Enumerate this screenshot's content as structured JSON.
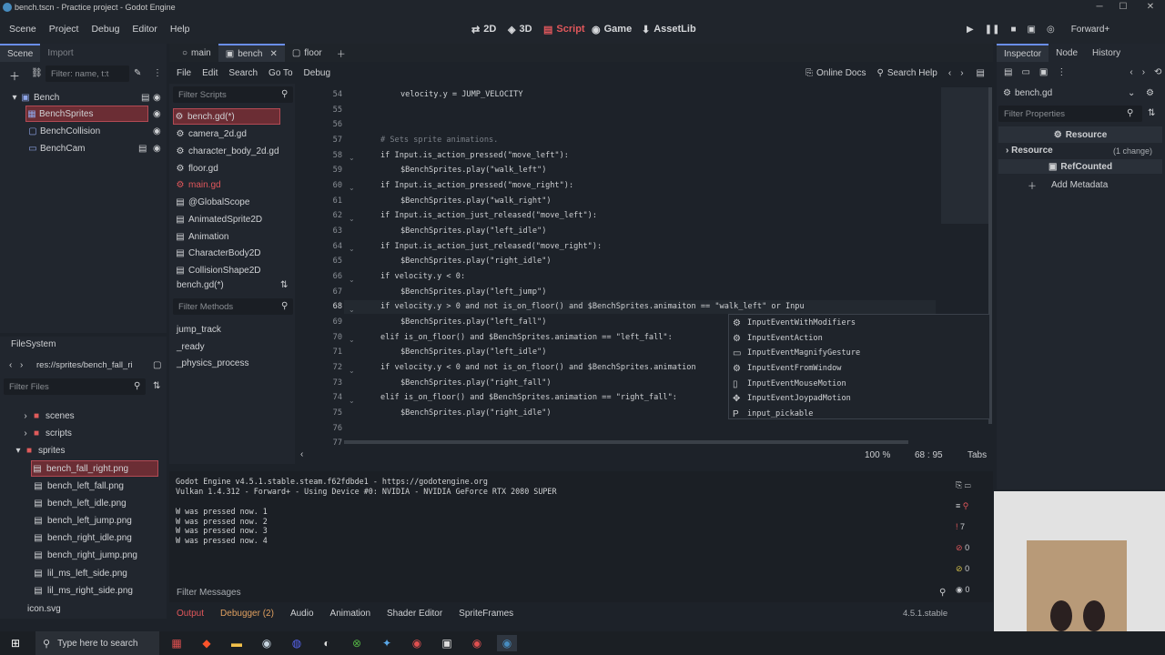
{
  "window": {
    "title": "bench.tscn - Practice project - Godot Engine"
  },
  "menu": [
    "Scene",
    "Project",
    "Debug",
    "Editor",
    "Help"
  ],
  "modes": [
    {
      "label": "2D"
    },
    {
      "label": "3D"
    },
    {
      "label": "Script"
    },
    {
      "label": "Game"
    },
    {
      "label": "AssetLib"
    }
  ],
  "renderer": "Forward+",
  "scene_panel": {
    "tabs": [
      "Scene",
      "Import"
    ],
    "filter_placeholder": "Filter: name, t:t",
    "nodes": [
      "Bench",
      "BenchSprites",
      "BenchCollision",
      "BenchCam"
    ]
  },
  "filesystem": {
    "title": "FileSystem",
    "path": "res://sprites/bench_fall_ri",
    "filter_placeholder": "Filter Files",
    "folders": [
      "scenes",
      "scripts",
      "sprites"
    ],
    "files": [
      "bench_fall_right.png",
      "bench_left_fall.png",
      "bench_left_idle.png",
      "bench_left_jump.png",
      "bench_right_idle.png",
      "bench_right_jump.png",
      "lil_ms_left_side.png",
      "lil_ms_right_side.png"
    ],
    "bottom_file": "icon.svg"
  },
  "editor_tabs": [
    "main",
    "bench",
    "floor"
  ],
  "script_menu": [
    "File",
    "Edit",
    "Search",
    "Go To",
    "Debug"
  ],
  "script_toolbar": {
    "online_docs": "Online Docs",
    "search_help": "Search Help"
  },
  "scripts_panel": {
    "filter_placeholder": "Filter Scripts",
    "items": [
      "bench.gd(*)",
      "camera_2d.gd",
      "character_body_2d.gd",
      "floor.gd",
      "main.gd",
      "@GlobalScope",
      "AnimatedSprite2D",
      "Animation",
      "CharacterBody2D",
      "CollisionShape2D"
    ],
    "current": "bench.gd(*)"
  },
  "methods_panel": {
    "filter_placeholder": "Filter Methods",
    "items": [
      "jump_track",
      "_ready",
      "_physics_process"
    ]
  },
  "code_lines": [
    {
      "n": "54",
      "text": "velocity.y = JUMP_VELOCITY"
    },
    {
      "n": "55",
      "text": ""
    },
    {
      "n": "56",
      "text": ""
    },
    {
      "n": "57",
      "text": "# Sets sprite animations."
    },
    {
      "n": "58",
      "text": "if Input.is_action_pressed(\"move_left\"):"
    },
    {
      "n": "59",
      "text": "$BenchSprites.play(\"walk_left\")"
    },
    {
      "n": "60",
      "text": "if Input.is_action_pressed(\"move_right\"):"
    },
    {
      "n": "61",
      "text": "$BenchSprites.play(\"walk_right\")"
    },
    {
      "n": "62",
      "text": "if Input.is_action_just_released(\"move_left\"):"
    },
    {
      "n": "63",
      "text": "$BenchSprites.play(\"left_idle\")"
    },
    {
      "n": "64",
      "text": "if Input.is_action_just_released(\"move_right\"):"
    },
    {
      "n": "65",
      "text": "$BenchSprites.play(\"right_idle\")"
    },
    {
      "n": "66",
      "text": "if velocity.y < 0:"
    },
    {
      "n": "67",
      "text": "$BenchSprites.play(\"left_jump\")"
    },
    {
      "n": "68",
      "text": "if velocity.y > 0 and not is_on_floor() and $BenchSprites.animaiton == \"walk_left\" or Inpu"
    },
    {
      "n": "69",
      "text": "$BenchSprites.play(\"left_fall\")"
    },
    {
      "n": "70",
      "text": "elif is_on_floor() and $BenchSprites.animation == \"left_fall\":"
    },
    {
      "n": "71",
      "text": "$BenchSprites.play(\"left_idle\")"
    },
    {
      "n": "72",
      "text": "if velocity.y < 0 and not is_on_floor() and $BenchSprites.animation"
    },
    {
      "n": "73",
      "text": "$BenchSprites.play(\"right_fall\")"
    },
    {
      "n": "74",
      "text": "elif is_on_floor() and $BenchSprites.animation == \"right_fall\":"
    },
    {
      "n": "75",
      "text": "$BenchSprites.play(\"right_idle\")"
    },
    {
      "n": "76",
      "text": ""
    },
    {
      "n": "77",
      "text": ""
    }
  ],
  "autocomplete": [
    "InputEventWithModifiers",
    "InputEventAction",
    "InputEventMagnifyGesture",
    "InputEventFromWindow",
    "InputEventMouseMotion",
    "InputEventJoypadMotion",
    "input_pickable"
  ],
  "status_bar": {
    "zoom": "100 %",
    "position": "68 :  95",
    "indent": "Tabs"
  },
  "output": {
    "lines": [
      "Godot Engine v4.5.1.stable.steam.f62fdbde1 - https://godotengine.org",
      "Vulkan 1.4.312 - Forward+ - Using Device #0: NVIDIA - NVIDIA GeForce RTX 2080 SUPER",
      "",
      "W was pressed now. 1",
      "W was pressed now. 2",
      "W was pressed now. 3",
      "W was pressed now. 4"
    ],
    "filter_placeholder": "Filter Messages",
    "counts": [
      "7",
      "0",
      "0",
      "0"
    ]
  },
  "bottom_tabs": [
    "Output",
    "Debugger (2)",
    "Audio",
    "Animation",
    "Shader Editor",
    "SpriteFrames"
  ],
  "version": "4.5.1.stable",
  "inspector": {
    "tabs": [
      "Inspector",
      "Node",
      "History"
    ],
    "file": "bench.gd",
    "filter_placeholder": "Filter Properties",
    "section": "Resource",
    "subsection": "Resource",
    "changes": "(1 change)",
    "refcounted": "RefCounted",
    "add_metadata": "Add Metadata"
  },
  "taskbar": {
    "search_placeholder": "Type here to search"
  },
  "colors": {
    "accent": "#e0575b",
    "selection": "#6b2d34",
    "background": "#1d2229"
  }
}
